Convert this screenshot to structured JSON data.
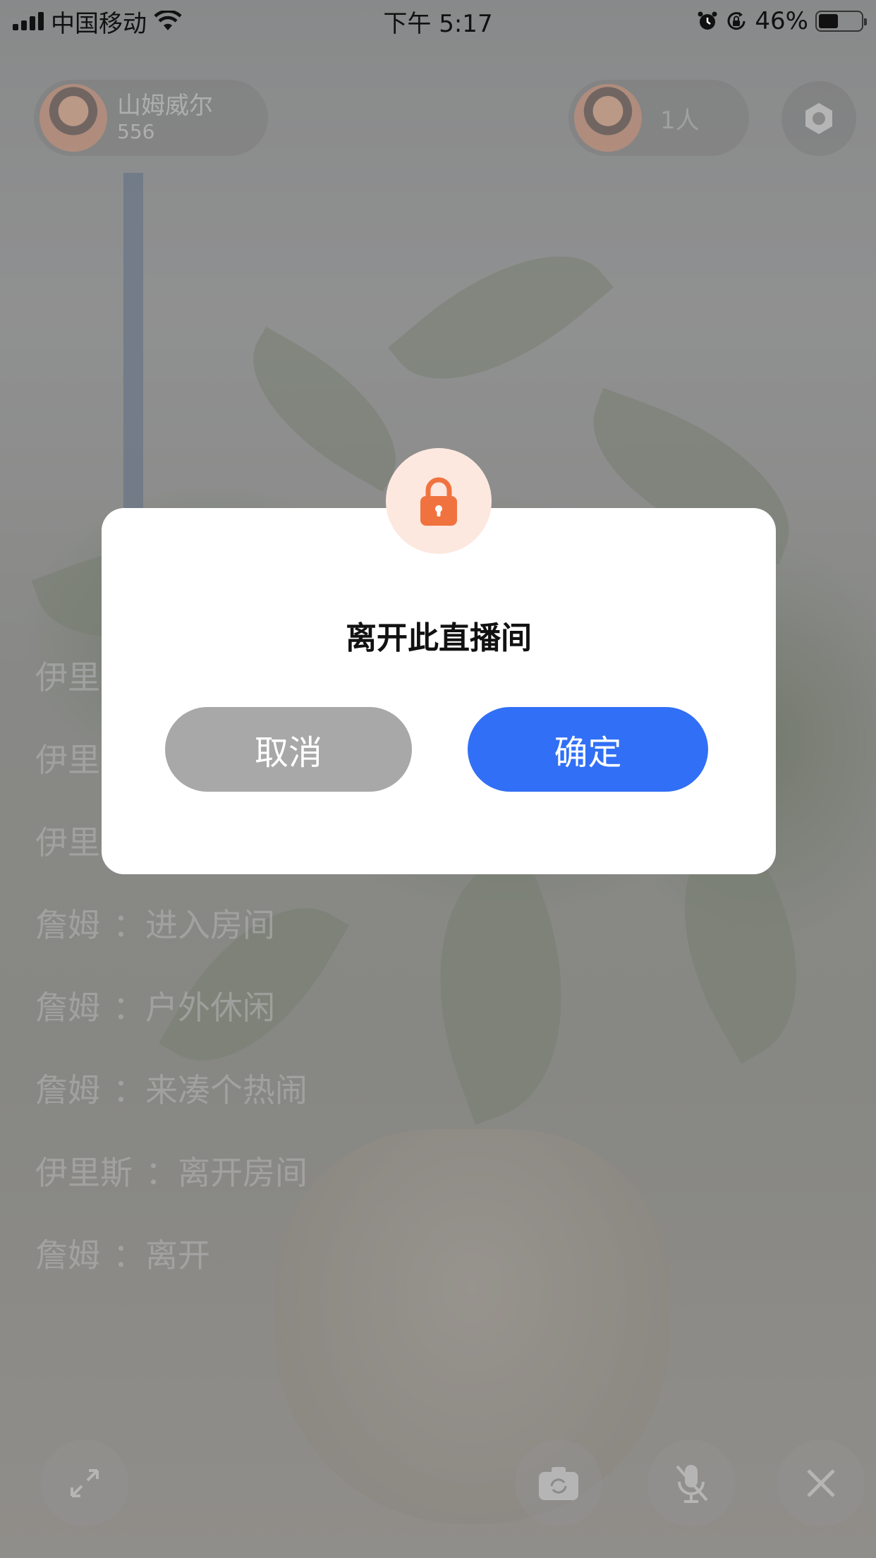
{
  "status_bar": {
    "carrier": "中国移动",
    "time": "下午 5:17",
    "battery_percent": "46%",
    "battery_level": 0.46,
    "icons": [
      "signal-icon",
      "wifi-icon",
      "alarm-icon",
      "rotation-lock-icon",
      "battery-icon"
    ]
  },
  "host": {
    "name": "山姆威尔",
    "count": "556"
  },
  "viewers": {
    "label": "1人"
  },
  "chat": [
    {
      "user": "伊里",
      "sep": "",
      "text": ""
    },
    {
      "user": "伊里",
      "sep": "",
      "text": ""
    },
    {
      "user": "伊里",
      "sep": "",
      "text": ""
    },
    {
      "user": "詹姆",
      "sep": "：",
      "text": "进入房间"
    },
    {
      "user": "詹姆",
      "sep": "：",
      "text": "户外休闲"
    },
    {
      "user": "詹姆",
      "sep": "：",
      "text": "来凑个热闹"
    },
    {
      "user": "伊里斯",
      "sep": "：",
      "text": "离开房间"
    },
    {
      "user": "詹姆",
      "sep": "：",
      "text": "离开"
    }
  ],
  "dialog": {
    "title": "离开此直播间",
    "cancel_label": "取消",
    "confirm_label": "确定",
    "icon": "lock-icon",
    "colors": {
      "confirm": "#316ff6",
      "cancel": "#a8a8a8",
      "lock": "#f0733f",
      "lock_badge": "#fde8e0"
    }
  }
}
